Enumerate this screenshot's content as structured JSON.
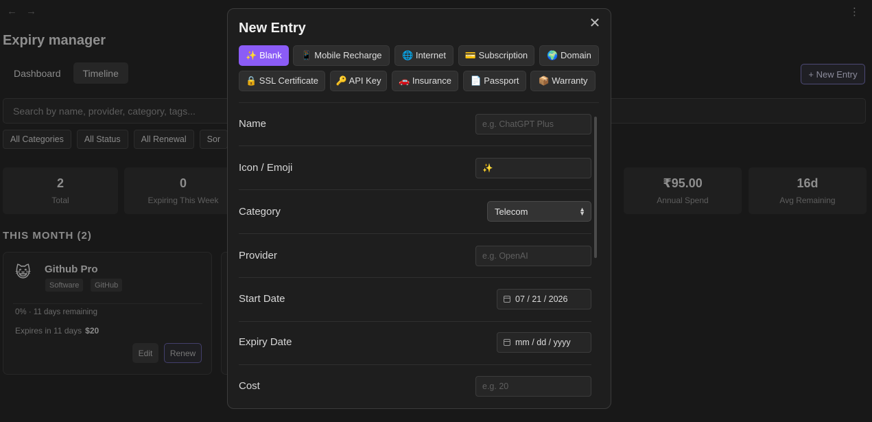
{
  "app": {
    "title": "Expiry manager",
    "nav_back": "←",
    "nav_forward": "→",
    "menu_glyph": "⋮",
    "tabs": [
      {
        "label": "Dashboard"
      },
      {
        "label": "Timeline"
      }
    ],
    "new_entry_label": "+ New Entry",
    "search_placeholder": "Search by name, provider, category, tags...",
    "filters": [
      "All Categories",
      "All Status",
      "All Renewal",
      "Sor"
    ],
    "stats": [
      {
        "value": "2",
        "label": "Total"
      },
      {
        "value": "0",
        "label": "Expiring This Week"
      },
      {
        "value": "₹95.00",
        "label": "Annual Spend"
      },
      {
        "value": "16d",
        "label": "Avg Remaining"
      }
    ],
    "section_title": "THIS MONTH (2)",
    "card": {
      "emoji": "😺",
      "name": "Github Pro",
      "tags": [
        "Software",
        "GitHub"
      ],
      "progress_text": "0% · 11 days remaining",
      "expires_text": "Expires in 11 days",
      "cost": "$20",
      "edit_label": "Edit",
      "renew_label": "Renew"
    }
  },
  "modal": {
    "title": "New Entry",
    "close_glyph": "✕",
    "templates": [
      {
        "label": "✨ Blank",
        "active": true
      },
      {
        "label": "📱 Mobile Recharge"
      },
      {
        "label": "🌐 Internet"
      },
      {
        "label": "💳 Subscription"
      },
      {
        "label": "🌍 Domain"
      },
      {
        "label": "🔒 SSL Certificate"
      },
      {
        "label": "🔑 API Key"
      },
      {
        "label": "🚗 Insurance"
      },
      {
        "label": "📄 Passport"
      },
      {
        "label": "📦 Warranty"
      }
    ],
    "fields": {
      "name": {
        "label": "Name",
        "placeholder": "e.g. ChatGPT Plus"
      },
      "icon": {
        "label": "Icon / Emoji",
        "value": "✨"
      },
      "category": {
        "label": "Category",
        "value": "Telecom"
      },
      "provider": {
        "label": "Provider",
        "placeholder": "e.g. OpenAI"
      },
      "start_date": {
        "label": "Start Date",
        "value": "07 / 21 / 2026"
      },
      "expiry_date": {
        "label": "Expiry Date",
        "value": "mm / dd / yyyy"
      },
      "cost": {
        "label": "Cost",
        "placeholder": "e.g. 20"
      }
    }
  }
}
